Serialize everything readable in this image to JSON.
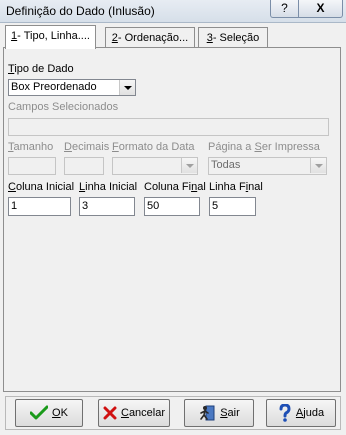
{
  "window": {
    "title": "Definição do Dado (Inlusão)",
    "help_glyph": "?",
    "close_glyph": "X"
  },
  "tabs": [
    {
      "mnemonic": "1",
      "rest": "- Tipo, Linha...."
    },
    {
      "mnemonic": "2",
      "rest": "- Ordenação..."
    },
    {
      "mnemonic": "3",
      "rest": "- Seleção"
    }
  ],
  "form": {
    "tipo_de_dado": {
      "label_mnemonic": "T",
      "label_rest": "ipo de Dado",
      "value": "Box Preordenado"
    },
    "campos_selecionados": {
      "label": "Campos Selecionados",
      "value": ""
    },
    "tamanho": {
      "label_mnemonic": "T",
      "label_rest": "amanho",
      "value": ""
    },
    "decimais": {
      "label_mnemonic": "D",
      "label_rest": "ecimais",
      "value": ""
    },
    "formato_data": {
      "label_pre": "",
      "label_mnemonic": "F",
      "label_rest": "ormato da Data",
      "value": ""
    },
    "pagina": {
      "label_pre": "Página a ",
      "label_mnemonic": "S",
      "label_rest": "er Impressa",
      "value": "Todas"
    },
    "coluna_inicial": {
      "label_pre": "",
      "label_mnemonic": "C",
      "label_rest": "oluna Inicial",
      "value": "1"
    },
    "linha_inicial": {
      "label_pre": "",
      "label_mnemonic": "L",
      "label_rest": "inha Inicial",
      "value": "3"
    },
    "coluna_final": {
      "label_pre": "Coluna Fi",
      "label_mnemonic": "n",
      "label_rest": "al",
      "value": "50"
    },
    "linha_final": {
      "label_pre": "Linha F",
      "label_mnemonic": "i",
      "label_rest": "nal",
      "value": "5"
    }
  },
  "buttons": {
    "ok": {
      "mnemonic": "O",
      "rest": "K"
    },
    "cancelar": {
      "mnemonic": "C",
      "rest": "ancelar"
    },
    "sair": {
      "mnemonic": "S",
      "rest": "air"
    },
    "ajuda": {
      "mnemonic": "A",
      "rest": "juda"
    }
  },
  "icons": {
    "ok": "check-icon",
    "cancelar": "red-x-icon",
    "sair": "exit-door-icon",
    "ajuda": "help-question-icon"
  },
  "colors": {
    "ok_check": "#1a9a1a",
    "cancel_x": "#d01010",
    "help_q": "#1e4fb5"
  }
}
